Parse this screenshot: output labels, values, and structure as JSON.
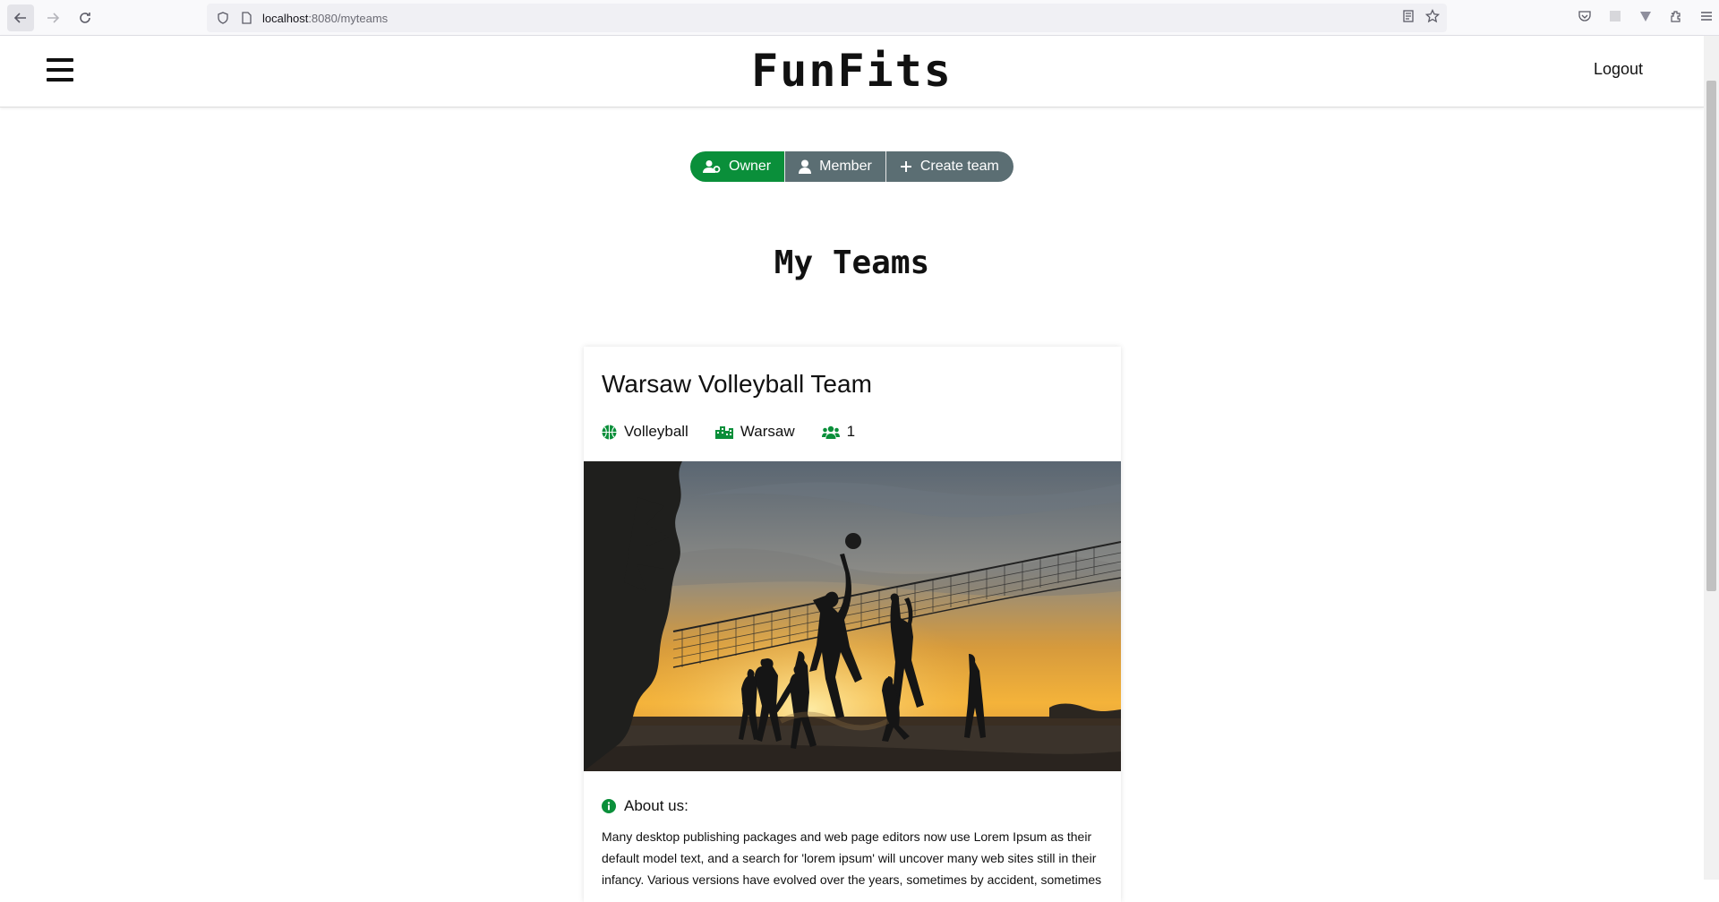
{
  "browser": {
    "url_host": "localhost",
    "url_rest": ":8080/myteams"
  },
  "header": {
    "brand": "FunFits",
    "logout_label": "Logout"
  },
  "team_filter": {
    "owner_label": "Owner",
    "member_label": "Member",
    "create_label": "Create team",
    "active": "Owner"
  },
  "page": {
    "title": "My Teams"
  },
  "team_card": {
    "name": "Warsaw Volleyball Team",
    "sport": "Volleyball",
    "city": "Warsaw",
    "members": "1",
    "about_label": "About us:",
    "about_text": "Many desktop publishing packages and web page editors now use Lorem Ipsum as their default model text, and a search for 'lorem ipsum' will uncover many web sites still in their infancy. Various versions have evolved over the years, sometimes by accident, sometimes"
  },
  "colors": {
    "accent_green": "#0a8f3a",
    "button_gray": "#5b6e73"
  }
}
